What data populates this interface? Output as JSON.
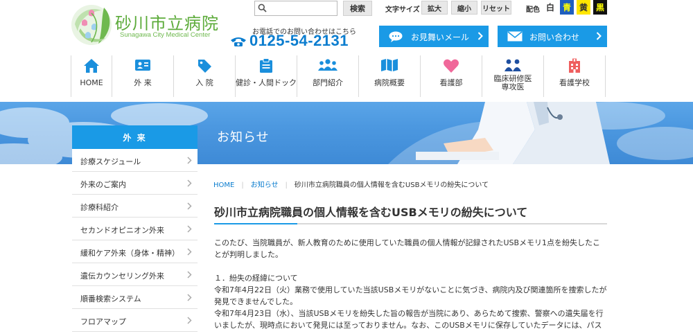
{
  "logo": {
    "name_jp": "砂川市立病院",
    "name_en": "Sunagawa City Medical Center"
  },
  "search": {
    "placeholder": "",
    "button_label": "検索"
  },
  "font_size": {
    "label": "文字サイズ",
    "buttons": [
      "拡大",
      "縮小",
      "リセット"
    ]
  },
  "color_scheme": {
    "label": "配色",
    "options": [
      {
        "label": "白",
        "bg": "#ffffff",
        "fg": "#333333"
      },
      {
        "label": "青",
        "bg": "#1e5fbf",
        "fg": "#ffff00"
      },
      {
        "label": "黄",
        "bg": "#ffe600",
        "fg": "#333333"
      },
      {
        "label": "黒",
        "bg": "#111111",
        "fg": "#ffff00"
      }
    ]
  },
  "contact": {
    "phone_lead": "お電話でのお問い合わせはこちら",
    "phone": "0125-54-2131",
    "mail_visit_label": "お見舞いメール",
    "inquiry_label": "お問い合わせ"
  },
  "gnav": {
    "items": [
      {
        "label": "HOME",
        "icon": "home-icon"
      },
      {
        "label": "外 来",
        "icon": "outpatient-card-icon"
      },
      {
        "label": "入 院",
        "icon": "tag-icon"
      },
      {
        "label": "健診・人間ドック",
        "icon": "clipboard-icon"
      },
      {
        "label": "部門紹介",
        "icon": "people-icon"
      },
      {
        "label": "病院概要",
        "icon": "map-icon"
      },
      {
        "label": "看護部",
        "icon": "heart-icon"
      },
      {
        "label": "臨床研修医\n専攻医",
        "icon": "doctors-icon"
      },
      {
        "label": "看護学校",
        "icon": "building-icon"
      }
    ]
  },
  "banner": {
    "title": "お知らせ"
  },
  "sidebar": {
    "heading": "外 来",
    "items": [
      "診療スケジュール",
      "外来のご案内",
      "診療科紹介",
      "セカンドオピニオン外来",
      "緩和ケア外来（身体・精神）",
      "遺伝カウンセリング外来",
      "順番検索システム",
      "フロアマップ"
    ]
  },
  "breadcrumb": {
    "home": "HOME",
    "section": "お知らせ",
    "current": "砂川市立病院職員の個人情報を含むUSBメモリの紛失について"
  },
  "article": {
    "title": "砂川市立病院職員の個人情報を含むUSBメモリの紛失について",
    "intro_line1": "このたび、当院職員が、新人教育のために使用していた職員の個人情報が記録されたUSBメモリ1点を紛失したこ",
    "intro_line2": "とが判明しました。",
    "section1_heading": "１．紛失の経緯について",
    "s1_line1": "令和7年4月22日（火）業務で使用していた当該USBメモリがないことに気づき、病院内及び関連箇所を捜索したが",
    "s1_line2": "発見できませんでした。",
    "s1_line3": "令和7年4月23日（水）、当該USBメモリを紛失した旨の報告が当院にあり、あらためて捜索、警察への遺失届を行",
    "s1_line4": "いましたが、現時点において発見には至っておりません。なお、このUSBメモリに保存していたデータには、パス"
  },
  "colors": {
    "accent_blue": "#1a9ae6",
    "link_blue": "#0b7dcf",
    "logo_green": "#5cab3a",
    "nav_icon_blue": "#1a8fdc",
    "heart_pink": "#f0689a",
    "building_red": "#ef5f5f"
  }
}
